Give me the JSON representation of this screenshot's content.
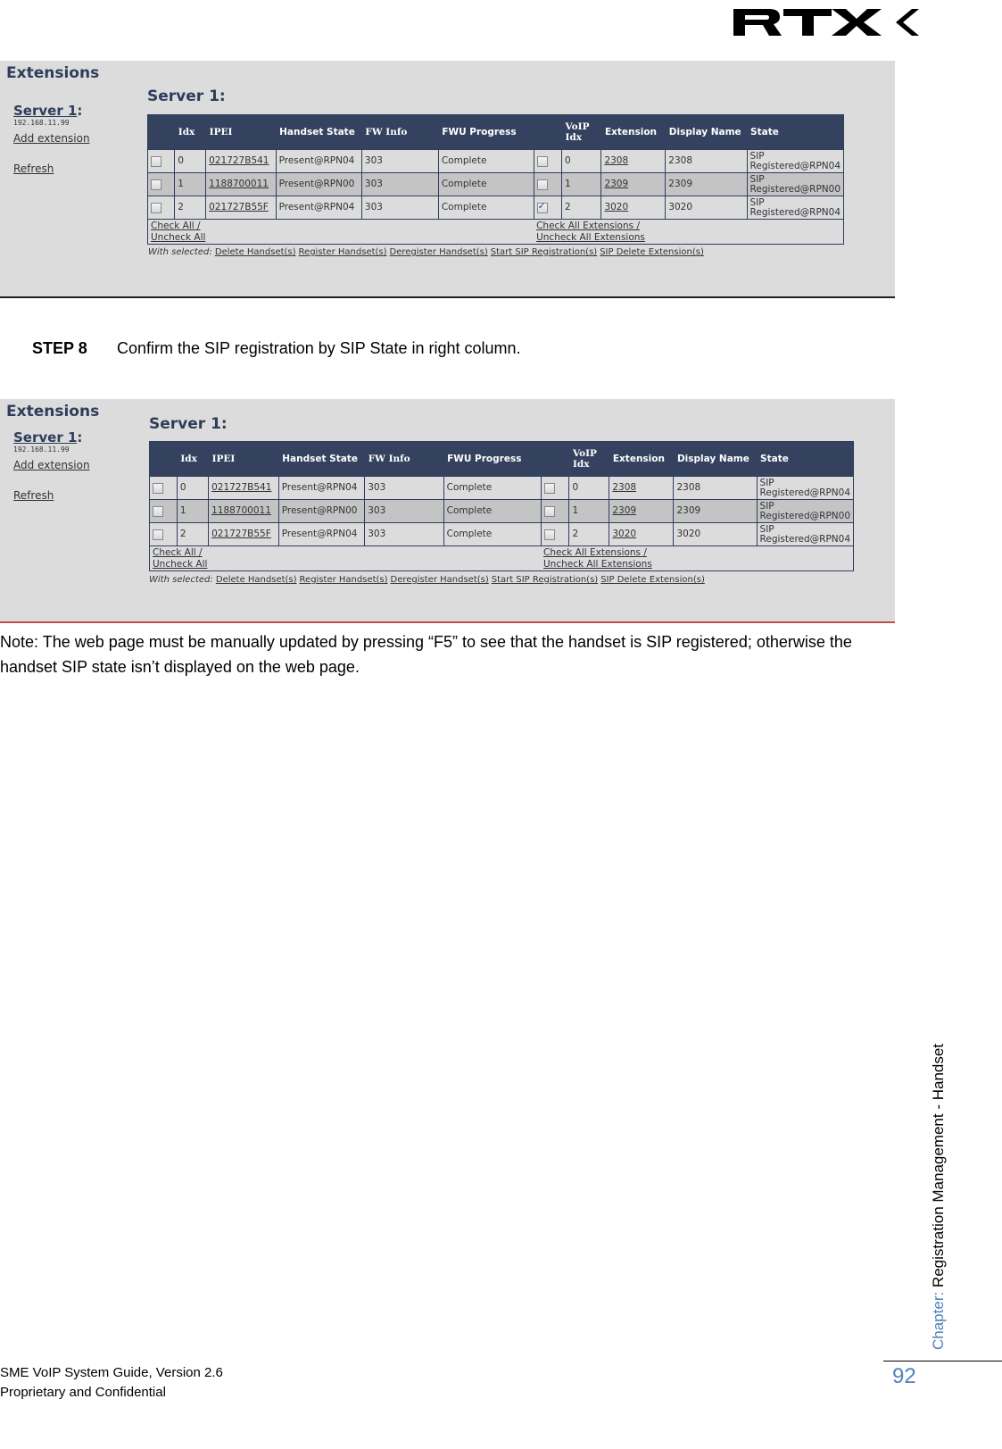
{
  "logo": {
    "text": "RTX"
  },
  "screenshots": [
    {
      "section_title": "Extensions",
      "sidebar": {
        "server_link": "Server 1",
        "server_suffix": ":",
        "server_ip": "192.168.11.99",
        "add_extension": "Add extension",
        "refresh": "Refresh"
      },
      "server_title": "Server 1:",
      "headers": [
        "",
        "Idx",
        "IPEI",
        "Handset State",
        "FW Info",
        "FWU Progress",
        "",
        "VoIP Idx",
        "Extension",
        "Display Name",
        "State"
      ],
      "rows": [
        {
          "checked": false,
          "idx": "0",
          "ipei": "021727B541",
          "handset_state": "Present@RPN04",
          "fw_info": "303",
          "fwu_progress": "Complete",
          "ext_checked": false,
          "voip_idx": "0",
          "extension": "2308",
          "display_name": "2308",
          "state_line1": "SIP",
          "state_line2": "Registered@RPN04"
        },
        {
          "checked": false,
          "idx": "1",
          "ipei": "1188700011",
          "handset_state": "Present@RPN00",
          "fw_info": "303",
          "fwu_progress": "Complete",
          "ext_checked": false,
          "voip_idx": "1",
          "extension": "2309",
          "display_name": "2309",
          "state_line1": "SIP",
          "state_line2": "Registered@RPN00"
        },
        {
          "checked": false,
          "idx": "2",
          "ipei": "021727B55F",
          "handset_state": "Present@RPN04",
          "fw_info": "303",
          "fwu_progress": "Complete",
          "ext_checked": true,
          "voip_idx": "2",
          "extension": "3020",
          "display_name": "3020",
          "state_line1": "SIP",
          "state_line2": "Registered@RPN04"
        }
      ],
      "footer": {
        "check_all": "Check All /",
        "uncheck_all": "Uncheck All",
        "check_all_ext": "Check All Extensions /",
        "uncheck_all_ext": "Uncheck All Extensions"
      },
      "with_selected": {
        "label": "With selected:",
        "actions": [
          "Delete Handset(s)",
          "Register Handset(s)",
          "Deregister Handset(s)",
          "Start SIP Registration(s)",
          "SIP Delete Extension(s)"
        ]
      }
    },
    {
      "section_title": "Extensions",
      "sidebar": {
        "server_link": "Server 1",
        "server_suffix": ":",
        "server_ip": "192.168.11.99",
        "add_extension": "Add extension",
        "refresh": "Refresh"
      },
      "server_title": "Server 1:",
      "headers": [
        "",
        "Idx",
        "IPEI",
        "Handset State",
        "FW Info",
        "FWU Progress",
        "",
        "VoIP Idx",
        "Extension",
        "Display Name",
        "State"
      ],
      "rows": [
        {
          "checked": false,
          "idx": "0",
          "ipei": "021727B541",
          "handset_state": "Present@RPN04",
          "fw_info": "303",
          "fwu_progress": "Complete",
          "ext_checked": false,
          "voip_idx": "0",
          "extension": "2308",
          "display_name": "2308",
          "state_line1": "SIP",
          "state_line2": "Registered@RPN04"
        },
        {
          "checked": false,
          "idx": "1",
          "ipei": "1188700011",
          "handset_state": "Present@RPN00",
          "fw_info": "303",
          "fwu_progress": "Complete",
          "ext_checked": false,
          "voip_idx": "1",
          "extension": "2309",
          "display_name": "2309",
          "state_line1": "SIP",
          "state_line2": "Registered@RPN00"
        },
        {
          "checked": false,
          "idx": "2",
          "ipei": "021727B55F",
          "handset_state": "Present@RPN04",
          "fw_info": "303",
          "fwu_progress": "Complete",
          "ext_checked": false,
          "voip_idx": "2",
          "extension": "3020",
          "display_name": "3020",
          "state_line1": "SIP",
          "state_line2": "Registered@RPN04"
        }
      ],
      "footer": {
        "check_all": "Check All /",
        "uncheck_all": "Uncheck All",
        "check_all_ext": "Check All Extensions /",
        "uncheck_all_ext": "Uncheck All Extensions"
      },
      "with_selected": {
        "label": "With selected:",
        "actions": [
          "Delete Handset(s)",
          "Register Handset(s)",
          "Deregister Handset(s)",
          "Start SIP Registration(s)",
          "SIP Delete Extension(s)"
        ]
      }
    }
  ],
  "step": {
    "label": "STEP 8",
    "text": "Confirm the SIP registration by SIP State in right column."
  },
  "note": "Note: The web page must be manually updated by pressing “F5” to see that the handset is SIP registered; otherwise the handset SIP state isn’t displayed on the web page.",
  "chapter": {
    "label": "Chapter:",
    "title": "Registration Management - Handset"
  },
  "page_number": "92",
  "footer": {
    "line1": "SME VoIP System Guide, Version 2.6",
    "line2": "Proprietary and Confidential"
  },
  "colors": {
    "header_bg": "#34425f",
    "title": "#2f3d5c",
    "panel_bg": "#dcdcdc",
    "accent_blue": "#4f81bd",
    "rule_red": "#c0504d"
  }
}
